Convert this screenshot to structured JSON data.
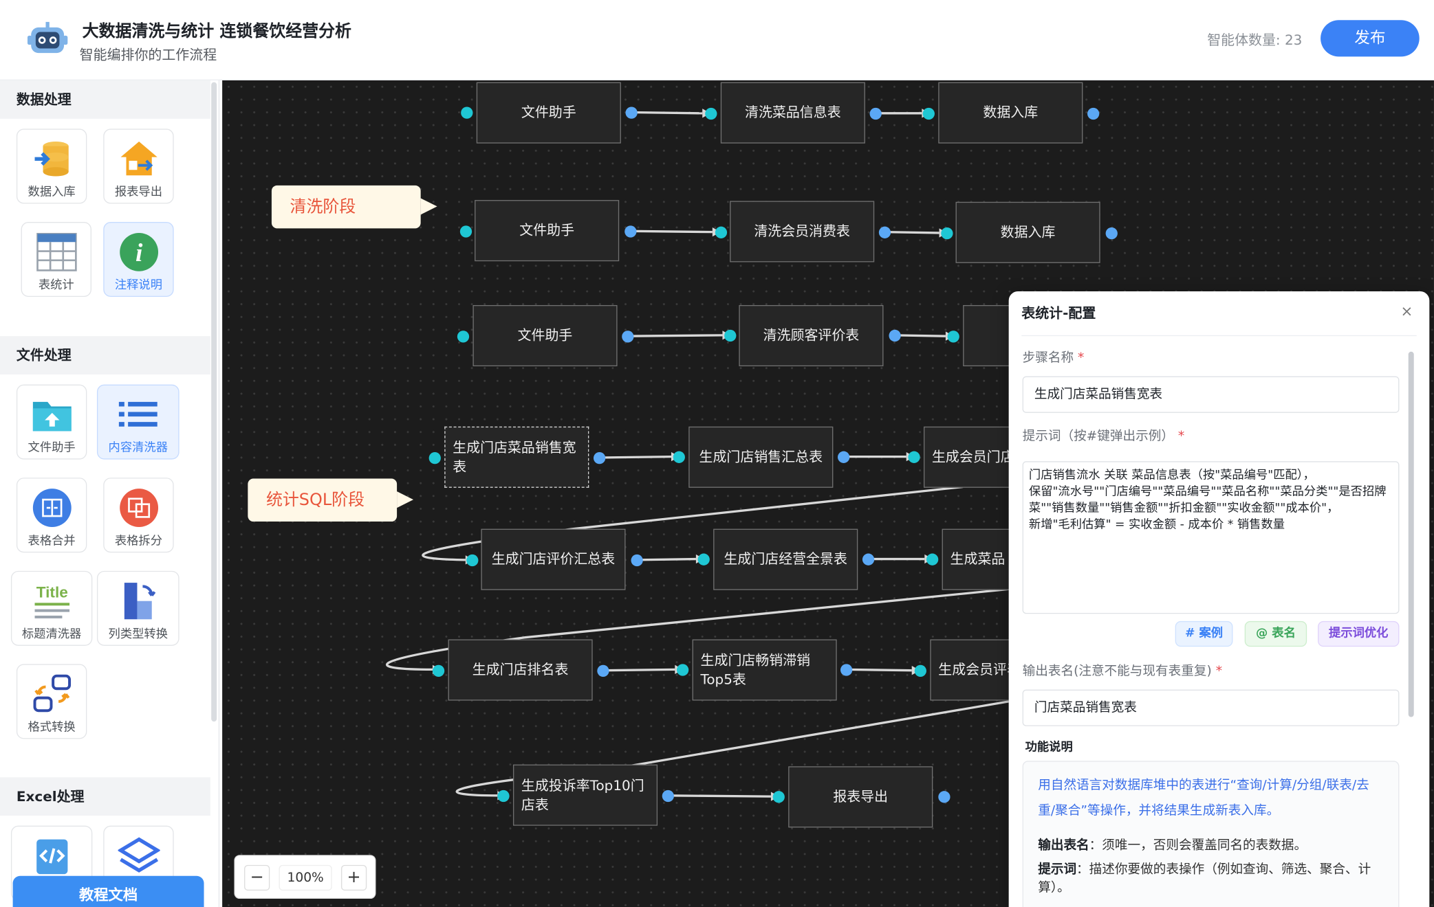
{
  "header": {
    "title": "大数据清洗与统计  连锁餐饮经营分析",
    "subtitle": "智能编排你的工作流程",
    "agent_count": "智能体数量: 23",
    "publish": "发布"
  },
  "sidebar": {
    "sections": [
      {
        "title": "数据处理",
        "items": [
          {
            "label": "数据入库",
            "icon": "database-import-icon"
          },
          {
            "label": "报表导出",
            "icon": "report-export-icon"
          },
          {
            "label": "表统计",
            "icon": "table-grid-icon"
          },
          {
            "label": "注释说明",
            "icon": "info-icon",
            "active": true
          }
        ]
      },
      {
        "title": "文件处理",
        "items": [
          {
            "label": "文件助手",
            "icon": "folder-upload-icon"
          },
          {
            "label": "内容清洗器",
            "icon": "list-icon",
            "active": true
          },
          {
            "label": "表格合并",
            "icon": "merge-icon"
          },
          {
            "label": "表格拆分",
            "icon": "split-icon"
          },
          {
            "label": "标题清洗器",
            "icon": "title-icon"
          },
          {
            "label": "列类型转换",
            "icon": "column-convert-icon"
          },
          {
            "label": "格式转换",
            "icon": "format-convert-icon"
          }
        ]
      },
      {
        "title": "Excel处理",
        "items": [
          {
            "label": "",
            "icon": "code-icon"
          },
          {
            "label": "",
            "icon": "layers-icon"
          }
        ]
      }
    ],
    "doc_button": "教程文档"
  },
  "canvas": {
    "notes": [
      "清洗阶段",
      "统计SQL阶段"
    ],
    "nodes": {
      "r1": [
        "文件助手",
        "清洗菜品信息表",
        "数据入库"
      ],
      "r2": [
        "文件助手",
        "清洗会员消费表",
        "数据入库"
      ],
      "r3": [
        "文件助手",
        "清洗顾客评价表"
      ],
      "r4": [
        "生成门店菜品销售宽表",
        "生成门店销售汇总表",
        "生成会员门店"
      ],
      "r5": [
        "生成门店评价汇总表",
        "生成门店经营全景表",
        "生成菜品"
      ],
      "r6": [
        "生成门店排名表",
        "生成门店畅销滞销Top5表",
        "生成会员评表"
      ],
      "r7": [
        "生成投诉率Top10门店表",
        "报表导出"
      ]
    },
    "zoom": {
      "minus": "−",
      "value": "100%",
      "plus": "+"
    }
  },
  "panel": {
    "title": "表统计-配置",
    "close": "×",
    "step_name_label": "步骤名称",
    "step_name_value": "生成门店菜品销售宽表",
    "prompt_label": "提示词（按#键弹出示例）",
    "prompt_value": "门店销售流水 关联 菜品信息表（按\"菜品编号\"匹配），\n保留\"流水号\"\"门店编号\"\"菜品编号\"\"菜品名称\"\"菜品分类\"\"是否招牌菜\"\"销售数量\"\"销售金额\"\"折扣金额\"\"实收金额\"\"成本价\"，\n新增\"毛利估算\" = 实收金额 - 成本价 * 销售数量",
    "chips": [
      "# 案例",
      "@ 表名",
      "提示词优化"
    ],
    "output_label": "输出表名(注意不能与现有表重复)",
    "output_value": "门店菜品销售宽表",
    "func_title": "功能说明",
    "func_desc": "用自然语言对数据库堆中的表进行“查询/计算/分组/联表/去重/聚合”等操作，并将结果生成新表入库。",
    "output_note_key": "输出表名",
    "output_note": "：须唯一，否则会覆盖同名的表数据。",
    "prompt_note_key": "提示词",
    "prompt_note": "：描述你要做的表操作（例如查询、筛选、聚合、计算）。"
  }
}
